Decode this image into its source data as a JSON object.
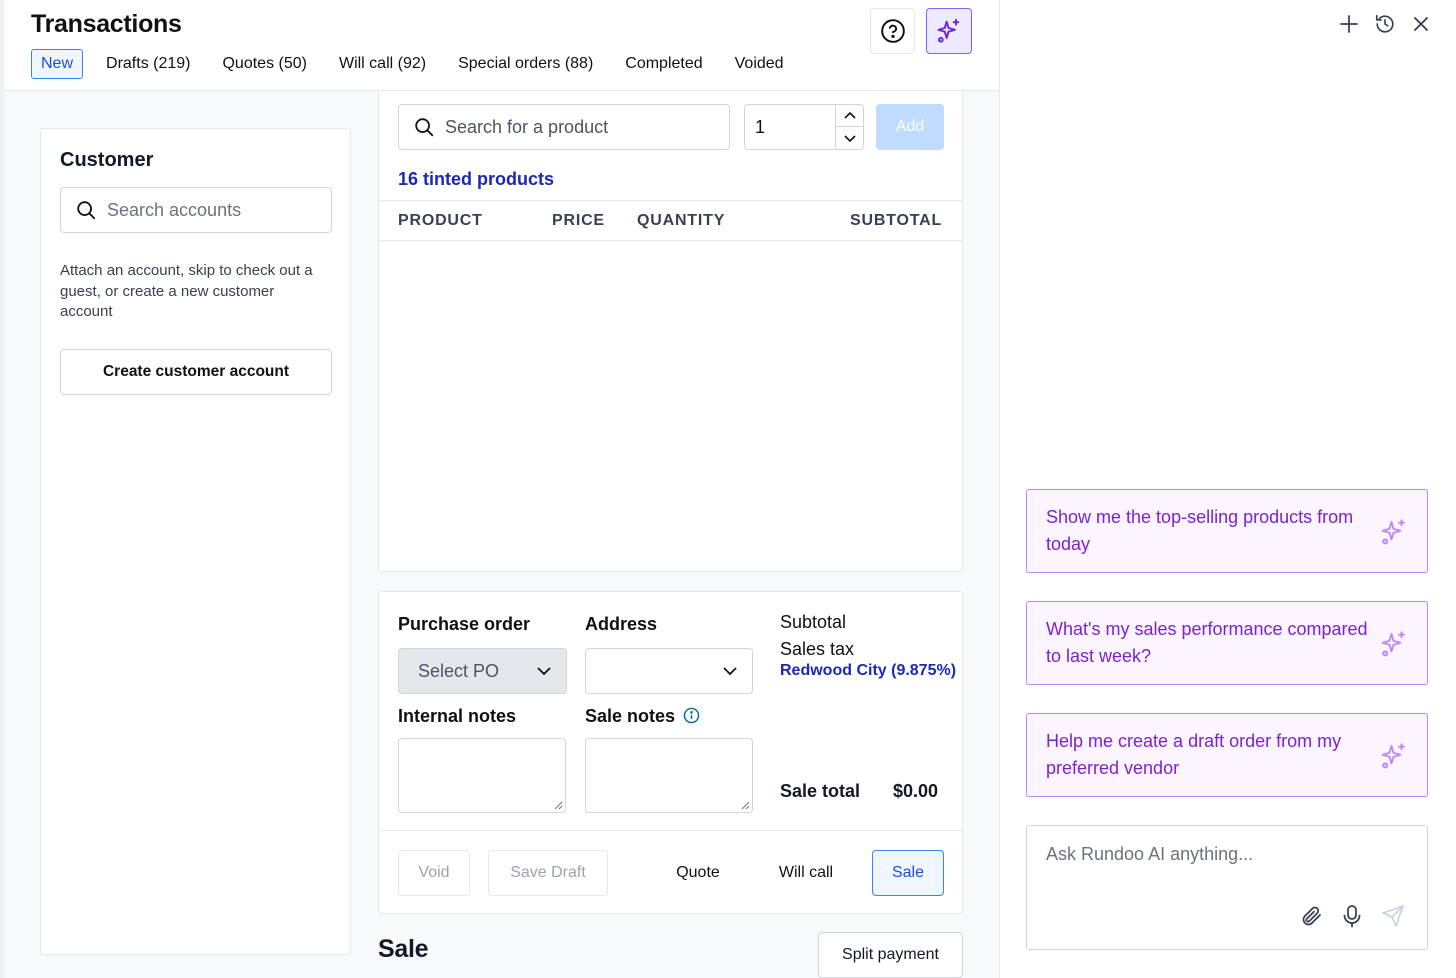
{
  "header": {
    "title": "Transactions",
    "tabs": [
      {
        "label": "New",
        "active": true
      },
      {
        "label": "Drafts (219)"
      },
      {
        "label": "Quotes (50)"
      },
      {
        "label": "Will call (92)"
      },
      {
        "label": "Special orders (88)"
      },
      {
        "label": "Completed"
      },
      {
        "label": "Voided"
      }
    ],
    "icons": {
      "help": "help-circle-icon",
      "ai": "sparkles-icon"
    }
  },
  "customer": {
    "title": "Customer",
    "search_placeholder": "Search accounts",
    "help_text": "Attach an account, skip to check out a guest, or create a new customer account",
    "create_button": "Create customer account"
  },
  "products": {
    "search_placeholder": "Search for a product",
    "quantity": "1",
    "add_button": "Add",
    "tinted_link": "16 tinted products",
    "columns": {
      "product": "PRODUCT",
      "price": "PRICE",
      "quantity": "QUANTITY",
      "subtotal": "SUBTOTAL"
    }
  },
  "order": {
    "purchase_order_label": "Purchase order",
    "purchase_order_placeholder": "Select PO",
    "address_label": "Address",
    "internal_notes_label": "Internal notes",
    "sale_notes_label": "Sale notes",
    "subtotal_label": "Subtotal",
    "sales_tax_label": "Sales tax",
    "tax_location": "Redwood City (9.875%)",
    "sale_total_label": "Sale total",
    "sale_total_value": "$0.00",
    "buttons": {
      "void": "Void",
      "save_draft": "Save Draft",
      "quote": "Quote",
      "will_call": "Will call",
      "sale": "Sale"
    }
  },
  "payment": {
    "heading": "Sale",
    "split_button": "Split payment"
  },
  "ai_panel": {
    "header_icons": [
      "plus-icon",
      "history-icon",
      "close-icon"
    ],
    "suggestions": [
      {
        "text": "Show me the top-selling products from today"
      },
      {
        "text": "What's my sales performance compared to last week?"
      },
      {
        "text": "Help me create a draft order from my preferred vendor"
      }
    ],
    "ask_placeholder": "Ask Rundoo AI anything...",
    "ask_icons": [
      "paperclip-icon",
      "microphone-icon",
      "send-icon"
    ]
  },
  "colors": {
    "accent_blue": "#1d4ed8",
    "link_blue": "#1d28b8",
    "ai_purple": "#7e22ce",
    "ai_border": "#c084fc"
  }
}
